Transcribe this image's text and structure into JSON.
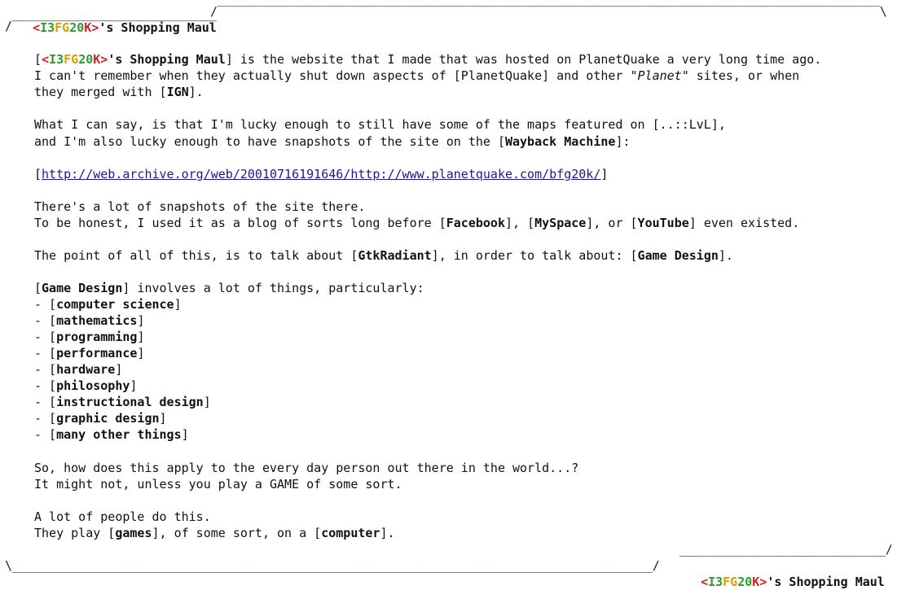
{
  "site": {
    "prefix": "<",
    "logo_i3": "I3",
    "logo_fg": "FG",
    "logo_20": "20",
    "logo_k": "K",
    "suffix": ">",
    "name_rest": "'s Shopping Maul"
  },
  "frame": {
    "top_right": "/‾‾‾‾‾‾‾‾‾‾‾‾‾‾‾‾‾‾‾‾‾‾‾‾‾‾‾‾‾‾‾‾‾‾‾‾‾‾‾‾‾‾‾‾‾‾‾‾‾‾‾‾‾‾‾‾‾‾‾‾‾‾‾‾‾‾‾‾‾‾‾‾‾‾‾‾‾‾‾‾‾‾‾‾‾‾‾‾‾‾\\",
    "top_left": "/‾‾‾‾‾‾‾‾‾‾‾‾‾‾‾‾‾‾‾‾‾‾‾‾‾‾‾‾",
    "bottom_right_top": "____________________________/",
    "bottom_left": "\\_______________________________________________________________________________________/"
  },
  "p1": {
    "a": "[",
    "b": "] is the website that I made that was hosted on PlanetQuake a very long time ago.",
    "l2a": "I can't remember when they actually shut down aspects of [PlanetQuake] and other \"",
    "l2b": "Planet",
    "l2c": "\" sites, or when",
    "l3a": "they merged with [",
    "l3b": "IGN",
    "l3c": "]."
  },
  "p2": {
    "l1": "What I can say, is that I'm lucky enough to still have some of the maps featured on [..::LvL],",
    "l2a": "and I'm also lucky enough to have snapshots of the site on the [",
    "l2b": "Wayback Machine",
    "l2c": "]:"
  },
  "link": {
    "open": "[",
    "url": "http://web.archive.org/web/20010716191646/http://www.planetquake.com/bfg20k/",
    "close": "]"
  },
  "p3": {
    "l1": "There's a lot of snapshots of the site there.",
    "l2a": "To be honest, I used it as a blog of sorts long before [",
    "fb": "Facebook",
    "l2b": "], [",
    "ms": "MySpace",
    "l2c": "], or [",
    "yt": "YouTube",
    "l2d": "] even existed."
  },
  "p4": {
    "a": "The point of all of this, is to talk about [",
    "gr": "GtkRadiant",
    "b": "], in order to talk about: [",
    "gd": "Game Design",
    "c": "]."
  },
  "p5": {
    "a": "[",
    "gd": "Game Design",
    "b": "] involves a lot of things, particularly:"
  },
  "list": [
    "computer science",
    "mathematics",
    "programming",
    "performance",
    "hardware",
    "philosophy",
    "instructional design",
    "graphic design",
    "many other things"
  ],
  "p6": {
    "l1": "So, how does this apply to the every day person out there in the world...?",
    "l2": "It might not, unless you play a GAME of some sort."
  },
  "p7": {
    "l1": "A lot of people do this.",
    "l2a": "They play [",
    "games": "games",
    "l2b": "], of some sort, on a [",
    "comp": "computer",
    "l2c": "]."
  }
}
